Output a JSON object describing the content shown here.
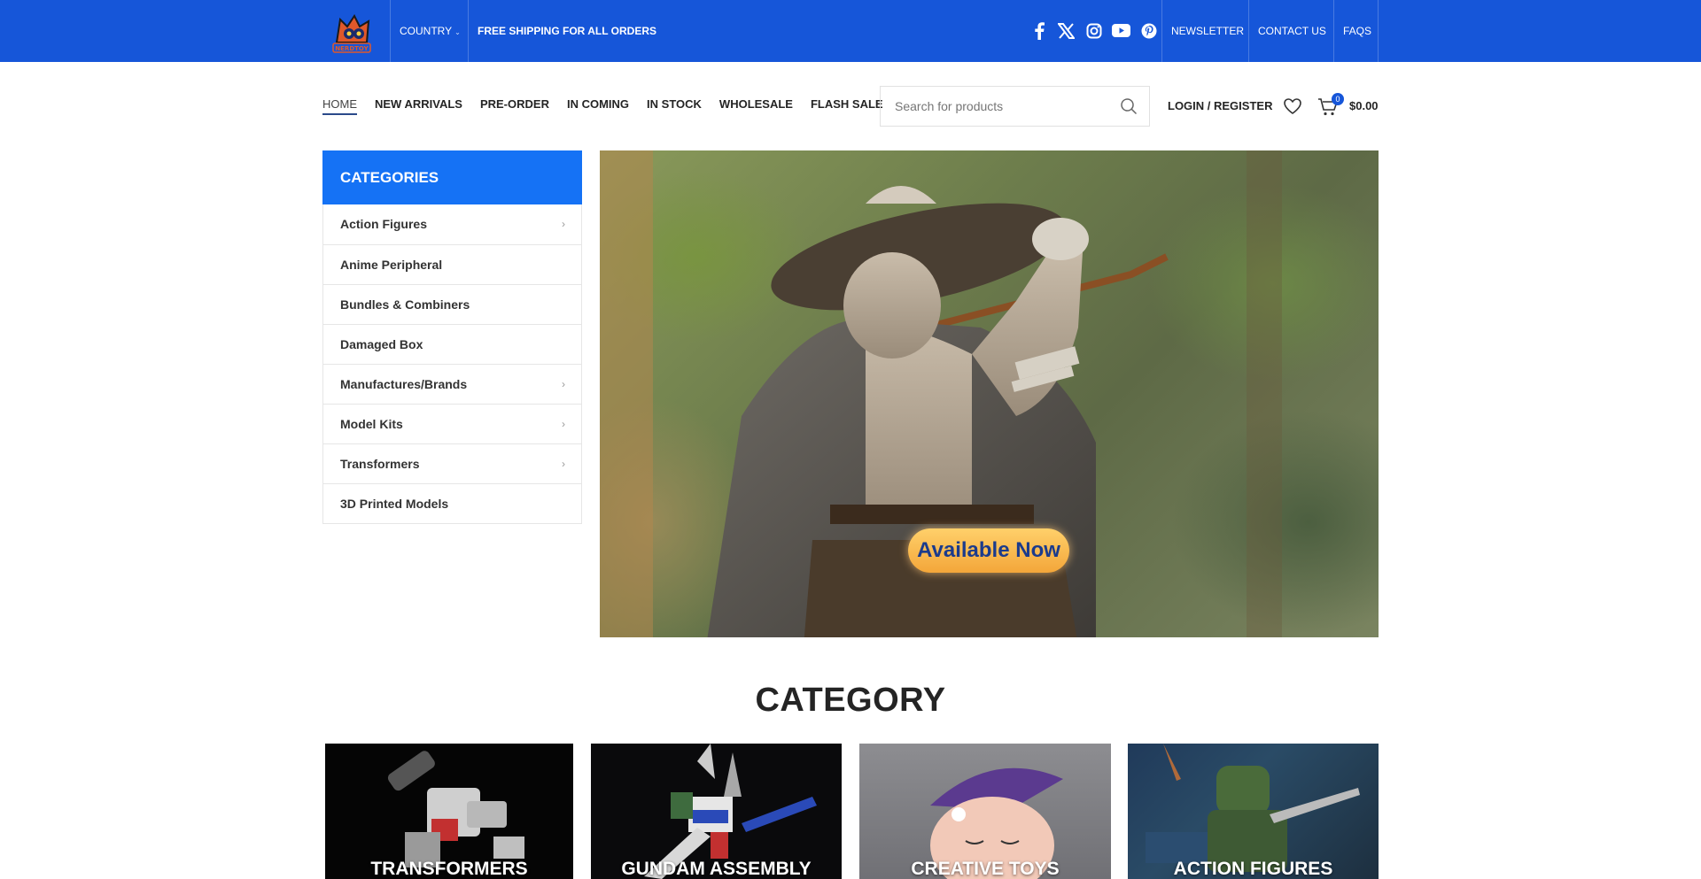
{
  "topbar": {
    "logo_text": "NERDTOY",
    "country_label": "COUNTRY",
    "shipping_text": "FREE SHIPPING FOR ALL ORDERS",
    "social": [
      "facebook-icon",
      "x-icon",
      "instagram-icon",
      "youtube-icon",
      "pinterest-icon"
    ],
    "links": [
      "NEWSLETTER",
      "CONTACT US",
      "FAQS"
    ],
    "bg_color": "#1656d9"
  },
  "nav": {
    "items": [
      "HOME",
      "NEW ARRIVALS",
      "PRE-ORDER",
      "IN COMING",
      "IN STOCK",
      "WHOLESALE",
      "FLASH SALE"
    ],
    "active": "HOME"
  },
  "search": {
    "placeholder": "Search for products"
  },
  "account": {
    "login_label": "LOGIN / REGISTER"
  },
  "cart": {
    "count": "0",
    "total": "$0.00"
  },
  "categories": {
    "title": "CATEGORIES",
    "items": [
      {
        "label": "Action Figures",
        "has_sub": true
      },
      {
        "label": "Anime Peripheral",
        "has_sub": false
      },
      {
        "label": "Bundles & Combiners",
        "has_sub": false
      },
      {
        "label": "Damaged Box",
        "has_sub": false
      },
      {
        "label": "Manufactures/Brands",
        "has_sub": true
      },
      {
        "label": "Model Kits",
        "has_sub": true
      },
      {
        "label": "Transformers",
        "has_sub": true
      },
      {
        "label": "3D Printed Models",
        "has_sub": false
      }
    ],
    "header_color": "#1572f5"
  },
  "hero": {
    "badge_text": "Available Now"
  },
  "category_section": {
    "title": "CATEGORY",
    "cards": [
      "TRANSFORMERS",
      "GUNDAM ASSEMBLY",
      "CREATIVE TOYS",
      "ACTION FIGURES"
    ]
  }
}
